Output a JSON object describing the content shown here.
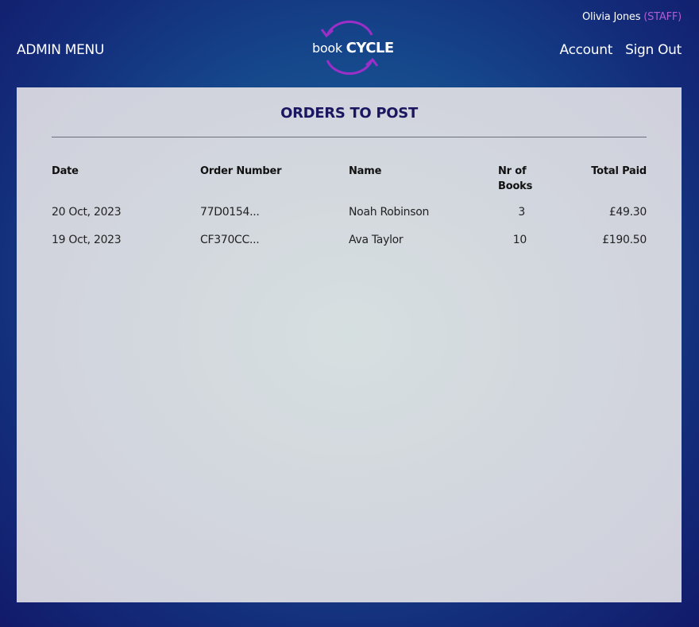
{
  "header": {
    "user_name": "Olivia Jones",
    "user_role": "(STAFF)",
    "admin_menu": "ADMIN MENU",
    "logo_book": "book",
    "logo_cycle": "CYCLE",
    "account": "Account",
    "sign_out": "Sign Out"
  },
  "main": {
    "title": "ORDERS TO POST",
    "columns": {
      "date": "Date",
      "order_number": "Order Number",
      "name": "Name",
      "nr_books_line1": "Nr of",
      "nr_books_line2": "Books",
      "total_paid": "Total Paid"
    },
    "orders": [
      {
        "date": "20 Oct, 2023",
        "order_number": "77D0154...",
        "name": "Noah Robinson",
        "books": "3",
        "total": "£49.30"
      },
      {
        "date": "19 Oct, 2023",
        "order_number": "CF370CC...",
        "name": "Ava Taylor",
        "books": "10",
        "total": "£190.50"
      }
    ]
  },
  "colors": {
    "accent": "#b25bd6",
    "title": "#1a1660",
    "background": "#164d8f"
  },
  "icons": {
    "logo": "recycle-arrows-icon"
  }
}
